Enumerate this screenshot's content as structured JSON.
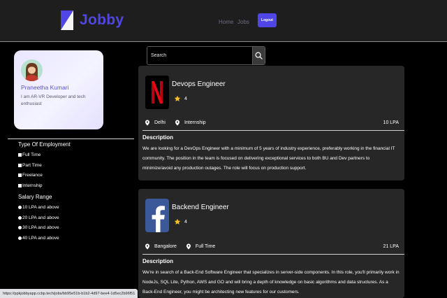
{
  "header": {
    "brand": "Jobby",
    "nav": [
      "Home",
      "Jobs"
    ],
    "logout_label": "Logout",
    "accent": "#4f46e5"
  },
  "profile": {
    "name": "Praneetha Kumari",
    "bio": "I am AR-VR Developer and tech enthusiast"
  },
  "filters": {
    "employment_heading": "Type Of Employment",
    "employment_types": [
      "Full Time",
      "Part Time",
      "Freelance",
      "Internship"
    ],
    "salary_heading": "Salary Range",
    "salary_ranges": [
      "10 LPA and above",
      "20 LPA and above",
      "30 LPA and above",
      "40 LPA and above"
    ]
  },
  "search": {
    "placeholder": "Search",
    "value": ""
  },
  "jobs": [
    {
      "title": "Devops Engineer",
      "rating": "4",
      "location": "Delhi",
      "employment_type": "Internship",
      "package": "10 LPA",
      "description_heading": "Description",
      "description": "We are looking for a DevOps Engineer with a minimum of 5 years of industry experience, preferably working in the financial IT community. The position in the team is focused on delivering exceptional services to both BU and Dev partners to minimize/avoid any production outages. The role will focus on production support.",
      "company_logo": "netflix-logo"
    },
    {
      "title": "Backend Engineer",
      "rating": "4",
      "location": "Bangalore",
      "employment_type": "Full Time",
      "package": "21 LPA",
      "description_heading": "Description",
      "description": "We're in search of a Back-End Software Engineer that specializes in server-side components. In this role, you'll primarily work in NodeJs, SQL Lite, Python, AWS and GO and will bring a depth of knowledge on basic algorithms and data structures. As a Back-End Engineer, you might be architecting new features for our customers.",
      "company_logo": "facebook-logo"
    }
  ],
  "status_bar": {
    "url": "https://ppkjobbyapp.ccbp.tech/jobs/bb95e51b-b1b2-4d97-bee4-1d5ec2b96f51"
  }
}
